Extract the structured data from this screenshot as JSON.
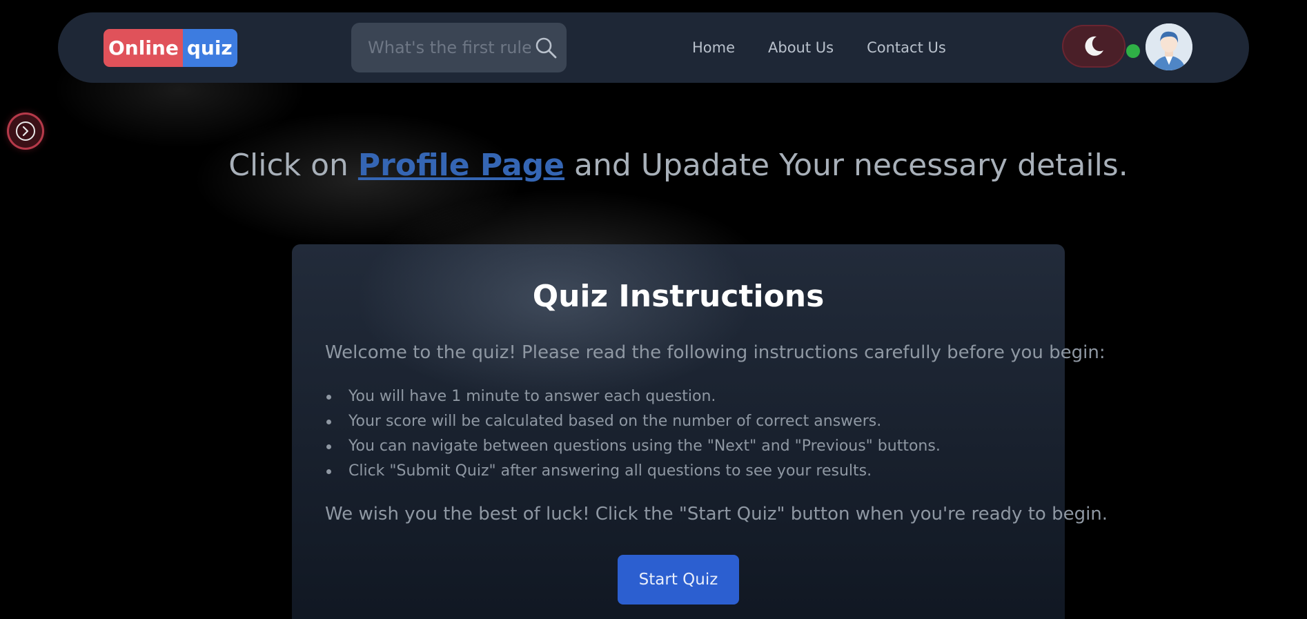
{
  "navbar": {
    "logo": {
      "part1": "Online",
      "part2": "quiz"
    },
    "search": {
      "placeholder": "What's the first rule ..."
    },
    "links": [
      {
        "label": "Home"
      },
      {
        "label": "About Us"
      },
      {
        "label": "Contact Us"
      }
    ],
    "theme_toggle_icon": "moon-icon",
    "avatar_icon": "user-avatar-icon",
    "status_color": "#2fb046"
  },
  "profile_message": {
    "before": "Click on ",
    "link": "Profile Page",
    "after": " and Upadate Your necessary details."
  },
  "instructions": {
    "title": "Quiz Instructions",
    "intro": "Welcome to the quiz! Please read the following instructions carefully before you begin:",
    "rules": [
      "You will have 1 minute to answer each question.",
      "Your score will be calculated based on the number of correct answers.",
      "You can navigate between questions using the \"Next\" and \"Previous\" buttons.",
      "Click \"Submit Quiz\" after answering all questions to see your results."
    ],
    "closing": "We wish you the best of luck! Click the \"Start Quiz\" button when you're ready to begin.",
    "start_button": "Start Quiz"
  },
  "colors": {
    "accent_blue": "#3d7ce0",
    "logo_red": "#e0525a",
    "button_blue": "#2c5fd0"
  }
}
